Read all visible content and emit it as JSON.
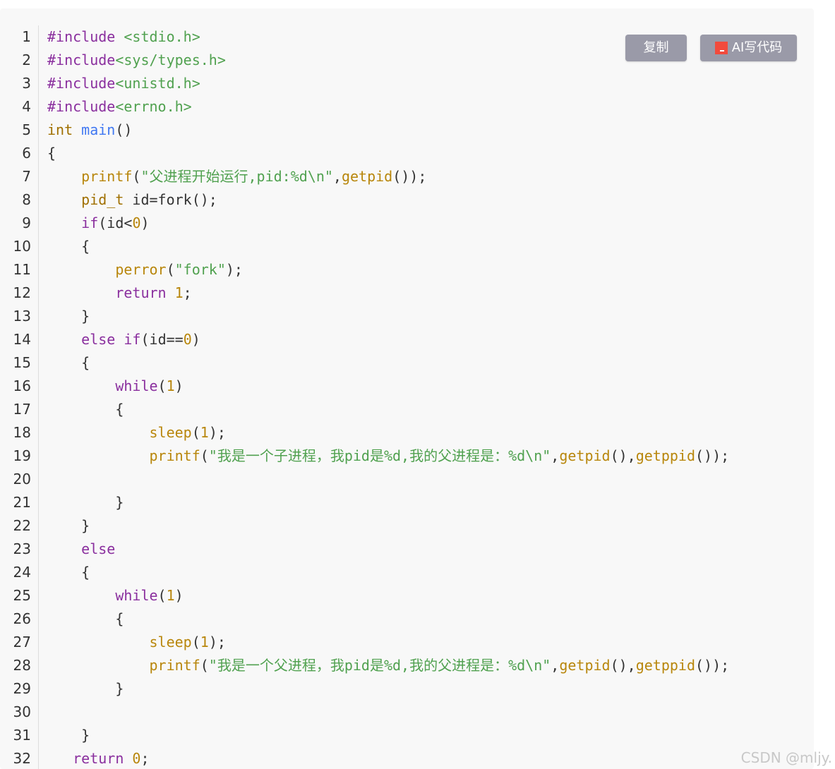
{
  "toolbar": {
    "copy_label": "复制",
    "ai_label": "AI写代码",
    "ai_icon": "csdn-ai-icon"
  },
  "watermark": "CSDN @mljy.",
  "lines": [
    {
      "n": "1",
      "tokens": [
        [
          "pp",
          "#include"
        ],
        [
          "plain",
          " "
        ],
        [
          "str",
          "<stdio.h>"
        ]
      ]
    },
    {
      "n": "2",
      "tokens": [
        [
          "pp",
          "#include"
        ],
        [
          "str",
          "<sys/types.h>"
        ]
      ]
    },
    {
      "n": "3",
      "tokens": [
        [
          "pp",
          "#include"
        ],
        [
          "str",
          "<unistd.h>"
        ]
      ]
    },
    {
      "n": "4",
      "tokens": [
        [
          "pp",
          "#include"
        ],
        [
          "str",
          "<errno.h>"
        ]
      ]
    },
    {
      "n": "5",
      "tokens": [
        [
          "type",
          "int"
        ],
        [
          "plain",
          " "
        ],
        [
          "def",
          "main"
        ],
        [
          "plain",
          "()"
        ]
      ]
    },
    {
      "n": "6",
      "tokens": [
        [
          "plain",
          "{"
        ]
      ]
    },
    {
      "n": "7",
      "tokens": [
        [
          "plain",
          "    "
        ],
        [
          "fn",
          "printf"
        ],
        [
          "plain",
          "("
        ],
        [
          "str",
          "\"父进程开始运行,pid:%d\\n\""
        ],
        [
          "plain",
          ","
        ],
        [
          "fn",
          "getpid"
        ],
        [
          "plain",
          "());"
        ]
      ]
    },
    {
      "n": "8",
      "tokens": [
        [
          "plain",
          "    "
        ],
        [
          "type",
          "pid_t"
        ],
        [
          "plain",
          " id=fork();"
        ]
      ]
    },
    {
      "n": "9",
      "tokens": [
        [
          "plain",
          "    "
        ],
        [
          "kw",
          "if"
        ],
        [
          "plain",
          "(id<"
        ],
        [
          "num",
          "0"
        ],
        [
          "plain",
          ")"
        ]
      ]
    },
    {
      "n": "10",
      "tokens": [
        [
          "plain",
          "    {"
        ]
      ]
    },
    {
      "n": "11",
      "tokens": [
        [
          "plain",
          "        "
        ],
        [
          "fn",
          "perror"
        ],
        [
          "plain",
          "("
        ],
        [
          "str",
          "\"fork\""
        ],
        [
          "plain",
          ");"
        ]
      ]
    },
    {
      "n": "12",
      "tokens": [
        [
          "plain",
          "        "
        ],
        [
          "kw",
          "return"
        ],
        [
          "plain",
          " "
        ],
        [
          "num",
          "1"
        ],
        [
          "plain",
          ";"
        ]
      ]
    },
    {
      "n": "13",
      "tokens": [
        [
          "plain",
          "    }"
        ]
      ]
    },
    {
      "n": "14",
      "tokens": [
        [
          "plain",
          "    "
        ],
        [
          "kw",
          "else"
        ],
        [
          "plain",
          " "
        ],
        [
          "kw",
          "if"
        ],
        [
          "plain",
          "(id=="
        ],
        [
          "num",
          "0"
        ],
        [
          "plain",
          ")"
        ]
      ]
    },
    {
      "n": "15",
      "tokens": [
        [
          "plain",
          "    {"
        ]
      ]
    },
    {
      "n": "16",
      "tokens": [
        [
          "plain",
          "        "
        ],
        [
          "kw",
          "while"
        ],
        [
          "plain",
          "("
        ],
        [
          "num",
          "1"
        ],
        [
          "plain",
          ")"
        ]
      ]
    },
    {
      "n": "17",
      "tokens": [
        [
          "plain",
          "        {"
        ]
      ]
    },
    {
      "n": "18",
      "tokens": [
        [
          "plain",
          "            "
        ],
        [
          "fn",
          "sleep"
        ],
        [
          "plain",
          "("
        ],
        [
          "num",
          "1"
        ],
        [
          "plain",
          ");"
        ]
      ]
    },
    {
      "n": "19",
      "tokens": [
        [
          "plain",
          "            "
        ],
        [
          "fn",
          "printf"
        ],
        [
          "plain",
          "("
        ],
        [
          "str",
          "\"我是一个子进程，我pid是%d,我的父进程是：%d\\n\""
        ],
        [
          "plain",
          ","
        ],
        [
          "fn",
          "getpid"
        ],
        [
          "plain",
          "(),"
        ],
        [
          "fn",
          "getppid"
        ],
        [
          "plain",
          "());"
        ]
      ]
    },
    {
      "n": "20",
      "tokens": []
    },
    {
      "n": "21",
      "tokens": [
        [
          "plain",
          "        }"
        ]
      ]
    },
    {
      "n": "22",
      "tokens": [
        [
          "plain",
          "    }"
        ]
      ]
    },
    {
      "n": "23",
      "tokens": [
        [
          "plain",
          "    "
        ],
        [
          "kw",
          "else"
        ]
      ]
    },
    {
      "n": "24",
      "tokens": [
        [
          "plain",
          "    {"
        ]
      ]
    },
    {
      "n": "25",
      "tokens": [
        [
          "plain",
          "        "
        ],
        [
          "kw",
          "while"
        ],
        [
          "plain",
          "("
        ],
        [
          "num",
          "1"
        ],
        [
          "plain",
          ")"
        ]
      ]
    },
    {
      "n": "26",
      "tokens": [
        [
          "plain",
          "        {"
        ]
      ]
    },
    {
      "n": "27",
      "tokens": [
        [
          "plain",
          "            "
        ],
        [
          "fn",
          "sleep"
        ],
        [
          "plain",
          "("
        ],
        [
          "num",
          "1"
        ],
        [
          "plain",
          ");"
        ]
      ]
    },
    {
      "n": "28",
      "tokens": [
        [
          "plain",
          "            "
        ],
        [
          "fn",
          "printf"
        ],
        [
          "plain",
          "("
        ],
        [
          "str",
          "\"我是一个父进程，我pid是%d,我的父进程是：%d\\n\""
        ],
        [
          "plain",
          ","
        ],
        [
          "fn",
          "getpid"
        ],
        [
          "plain",
          "(),"
        ],
        [
          "fn",
          "getppid"
        ],
        [
          "plain",
          "());"
        ]
      ]
    },
    {
      "n": "29",
      "tokens": [
        [
          "plain",
          "        }"
        ]
      ]
    },
    {
      "n": "30",
      "tokens": []
    },
    {
      "n": "31",
      "tokens": [
        [
          "plain",
          "    }"
        ]
      ]
    },
    {
      "n": "32",
      "tokens": [
        [
          "plain",
          "   "
        ],
        [
          "kw",
          "return"
        ],
        [
          "plain",
          " "
        ],
        [
          "num",
          "0"
        ],
        [
          "plain",
          ";"
        ]
      ]
    }
  ]
}
